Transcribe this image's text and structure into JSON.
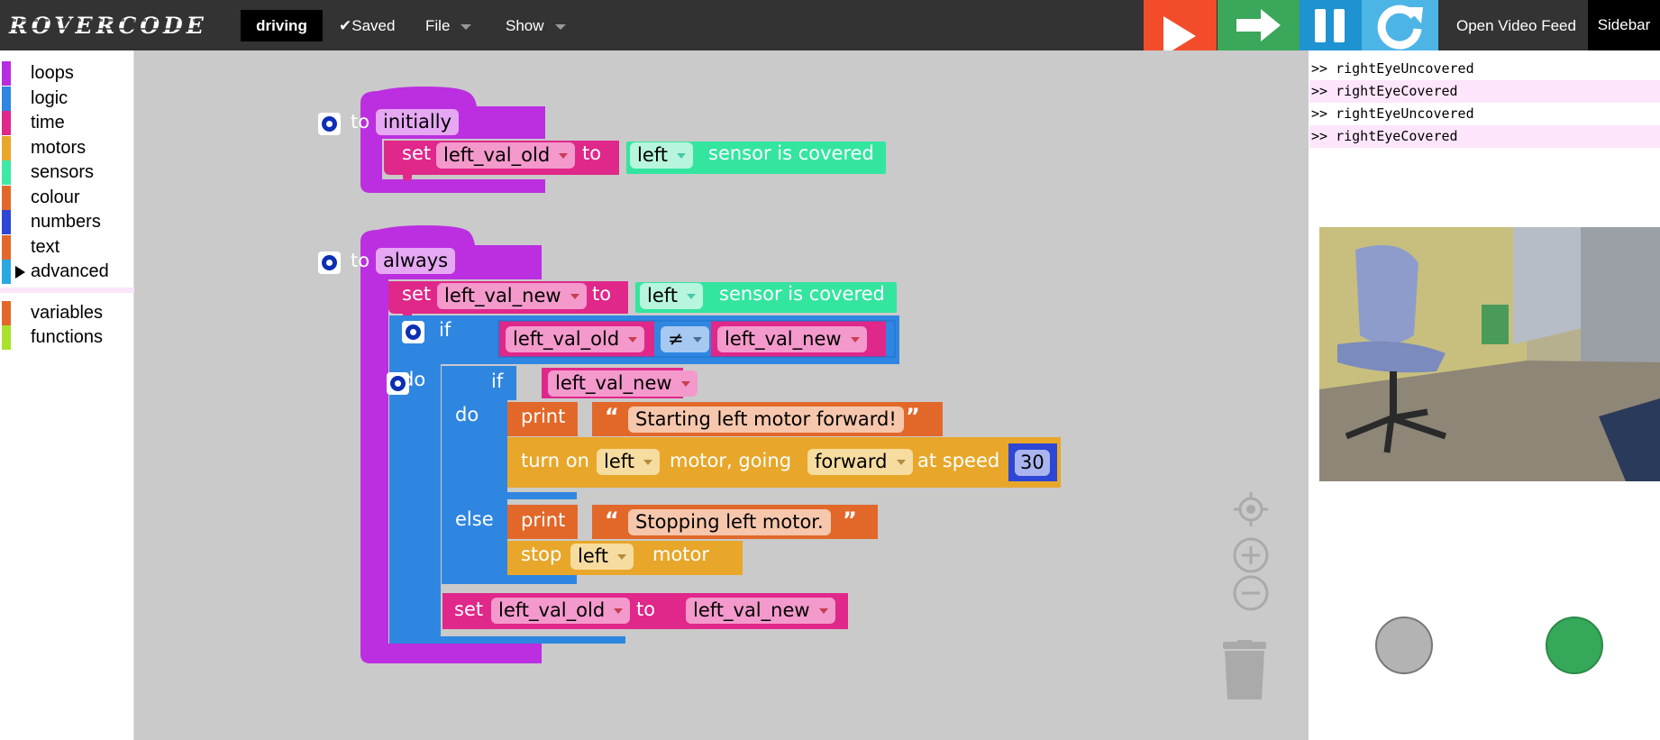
{
  "topbar": {
    "logo": "ROVERCODE",
    "program_name": "driving",
    "saved_label": "✔Saved",
    "file_label": "File",
    "show_label": "Show",
    "video_label": "Open Video Feed",
    "sidebar_label": "Sidebar",
    "controls": {
      "run": "play-icon",
      "step": "step-arrow-icon",
      "pause": "pause-icon",
      "reset": "reset-icon"
    },
    "colors": {
      "bar": "#333333",
      "run": "#f24c2a",
      "step": "#3ba75b",
      "pause": "#1f93d1",
      "reset": "#4db4e6"
    }
  },
  "toolbox": {
    "categories": [
      {
        "label": "loops",
        "color": "#b72ee0"
      },
      {
        "label": "logic",
        "color": "#2f86e0"
      },
      {
        "label": "time",
        "color": "#e0278a"
      },
      {
        "label": "motors",
        "color": "#e8a72a"
      },
      {
        "label": "sensors",
        "color": "#3ee8a7"
      },
      {
        "label": "colour",
        "color": "#e2682a"
      },
      {
        "label": "numbers",
        "color": "#2d46d6"
      },
      {
        "label": "text",
        "color": "#e2682a"
      },
      {
        "label": "advanced",
        "color": "#2aa8e0"
      }
    ],
    "extras": [
      {
        "label": "variables",
        "color": "#e2682a"
      },
      {
        "label": "functions",
        "color": "#a9e22d"
      }
    ]
  },
  "blocks": {
    "initially": {
      "to": "to",
      "name": "initially",
      "set": "set",
      "var": "left_val_old",
      "to2": "to",
      "side": "left",
      "sensor_text": "sensor is covered"
    },
    "always": {
      "to": "to",
      "name": "always",
      "set": "set",
      "var": "left_val_new",
      "to2": "to",
      "side": "left",
      "sensor_text": "sensor is covered",
      "if1": "if",
      "cmp_left": "left_val_old",
      "cmp_op": "≠",
      "cmp_right": "left_val_new",
      "do1": "do",
      "if2": "if",
      "if2_cond": "left_val_new",
      "do2": "do",
      "print1": "print",
      "print1_text": "Starting left motor forward!",
      "turn_on": "turn on",
      "motor_side": "left",
      "motor_going": "motor, going",
      "direction": "forward",
      "at_speed": "at speed",
      "speed": "30",
      "else": "else",
      "print2": "print",
      "print2_text": "Stopping left motor.",
      "stop": "stop",
      "stop_side": "left",
      "stop_motor": "motor",
      "set2": "set",
      "set2_var": "left_val_old",
      "set2_to": "to",
      "set2_val": "left_val_new"
    },
    "quote_open": "“",
    "quote_close": "”"
  },
  "sidebar": {
    "console_lines": [
      ">> rightEyeUncovered",
      ">> rightEyeCovered",
      ">> rightEyeUncovered",
      ">> rightEyeCovered"
    ],
    "sensor_left_color": "#b3b3b3",
    "sensor_right_color": "#35a859"
  }
}
